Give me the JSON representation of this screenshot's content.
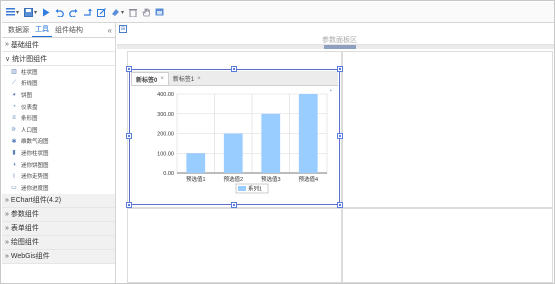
{
  "sidebar": {
    "tabs": [
      "数据源",
      "工具",
      "组件结构"
    ],
    "active_tab": 1,
    "collapse_glyph": "«",
    "groups_top": [
      {
        "label": "基础组件",
        "expanded": false
      },
      {
        "label": "统计图组件",
        "expanded": true
      }
    ],
    "chart_items": [
      {
        "label": "柱状图",
        "icon": "bar-chart-icon"
      },
      {
        "label": "折线图",
        "icon": "line-chart-icon"
      },
      {
        "label": "饼图",
        "icon": "pie-chart-icon"
      },
      {
        "label": "仪表盘",
        "icon": "gauge-icon"
      },
      {
        "label": "条形图",
        "icon": "horizontal-bar-icon"
      },
      {
        "label": "人口图",
        "icon": "population-chart-icon"
      },
      {
        "label": "维数气泡图",
        "icon": "bubble-chart-icon"
      },
      {
        "label": "迷你柱状图",
        "icon": "mini-bar-icon"
      },
      {
        "label": "迷你饼图图",
        "icon": "mini-pie-icon"
      },
      {
        "label": "迷你走势图",
        "icon": "mini-trend-icon"
      },
      {
        "label": "迷你进度图",
        "icon": "mini-progress-icon"
      }
    ],
    "groups_bottom": [
      {
        "label": "EChart组件(4.2)"
      },
      {
        "label": "参数组件"
      },
      {
        "label": "表单组件"
      },
      {
        "label": "绘图组件"
      },
      {
        "label": "WebGis组件"
      }
    ]
  },
  "toolbar": {
    "icons": [
      "menu-icon",
      "save-icon",
      "play-icon",
      "undo-icon",
      "redo-icon",
      "return-icon",
      "edit-icon",
      "paint-icon",
      "delete-icon",
      "hand-icon",
      "window-icon"
    ]
  },
  "workspace": {
    "param_area_title": "参数面板区",
    "component_tabs": [
      {
        "label": "新标签0",
        "close": "×",
        "active": true
      },
      {
        "label": "新标签1",
        "close": "×",
        "active": false
      }
    ]
  },
  "chart_data": {
    "type": "bar",
    "categories": [
      "预选值1",
      "预选值2",
      "预选值3",
      "预选值4"
    ],
    "series": [
      {
        "name": "系列1",
        "values": [
          100,
          200,
          300,
          400
        ]
      }
    ],
    "ylim": [
      0,
      400
    ],
    "yticks": [
      "0.00",
      "100.00",
      "200.00",
      "300.00",
      "400.00"
    ],
    "grid": true,
    "legend": "bottom-center",
    "color": "#99ccff"
  }
}
